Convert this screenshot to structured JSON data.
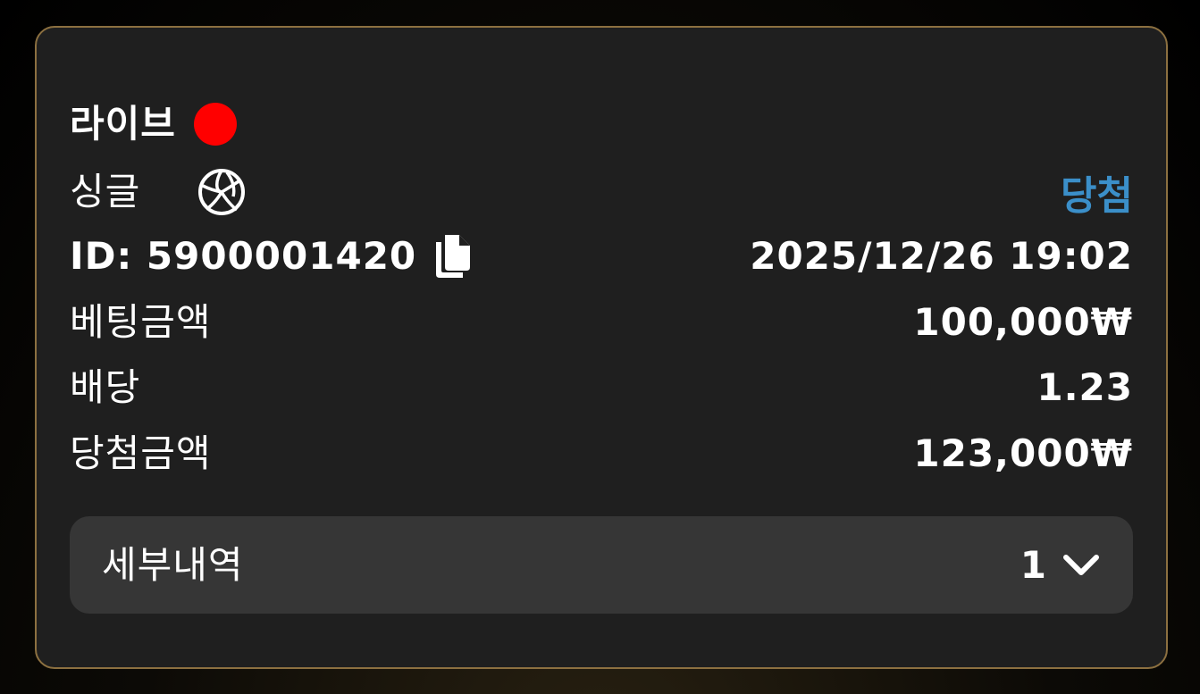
{
  "bet": {
    "mode_label": "라이브",
    "type_label": "싱글",
    "status": "당첨",
    "id_label": "ID: 5900001420",
    "datetime": "2025/12/26 19:02",
    "stake_label": "베팅금액",
    "stake_value": "100,000₩",
    "odds_label": "배당",
    "odds_value": "1.23",
    "payout_label": "당첨금액",
    "payout_value": "123,000₩"
  },
  "details": {
    "label": "세부내역",
    "count": "1"
  },
  "icons": {
    "live": "live-indicator-dot",
    "sport": "volleyball-icon",
    "copy": "copy-icon",
    "expand": "chevron-down-icon"
  },
  "colors": {
    "live_dot": "#ff0000",
    "status_win": "#3b8fc9",
    "card_border": "#8c7040",
    "card_bg": "#1f1f1f",
    "details_bg": "#363636"
  }
}
